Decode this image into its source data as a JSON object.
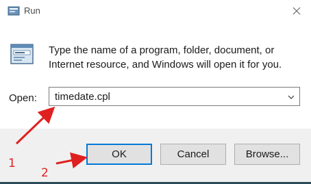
{
  "window": {
    "title": "Run",
    "title_icon": "run-app-icon",
    "close_icon": "close-icon"
  },
  "body": {
    "icon": "run-dialog-icon",
    "description": "Type the name of a program, folder, document, or Internet resource, and Windows will open it for you."
  },
  "open": {
    "label": "Open:",
    "value": "timedate.cpl",
    "dropdown_icon": "chevron-down-icon"
  },
  "buttons": {
    "ok": "OK",
    "cancel": "Cancel",
    "browse": "Browse..."
  },
  "annotations": {
    "step1": "1",
    "step2": "2",
    "color": "#e02020"
  },
  "colors": {
    "accent": "#0078d7",
    "footer": "#f0f0f0"
  }
}
